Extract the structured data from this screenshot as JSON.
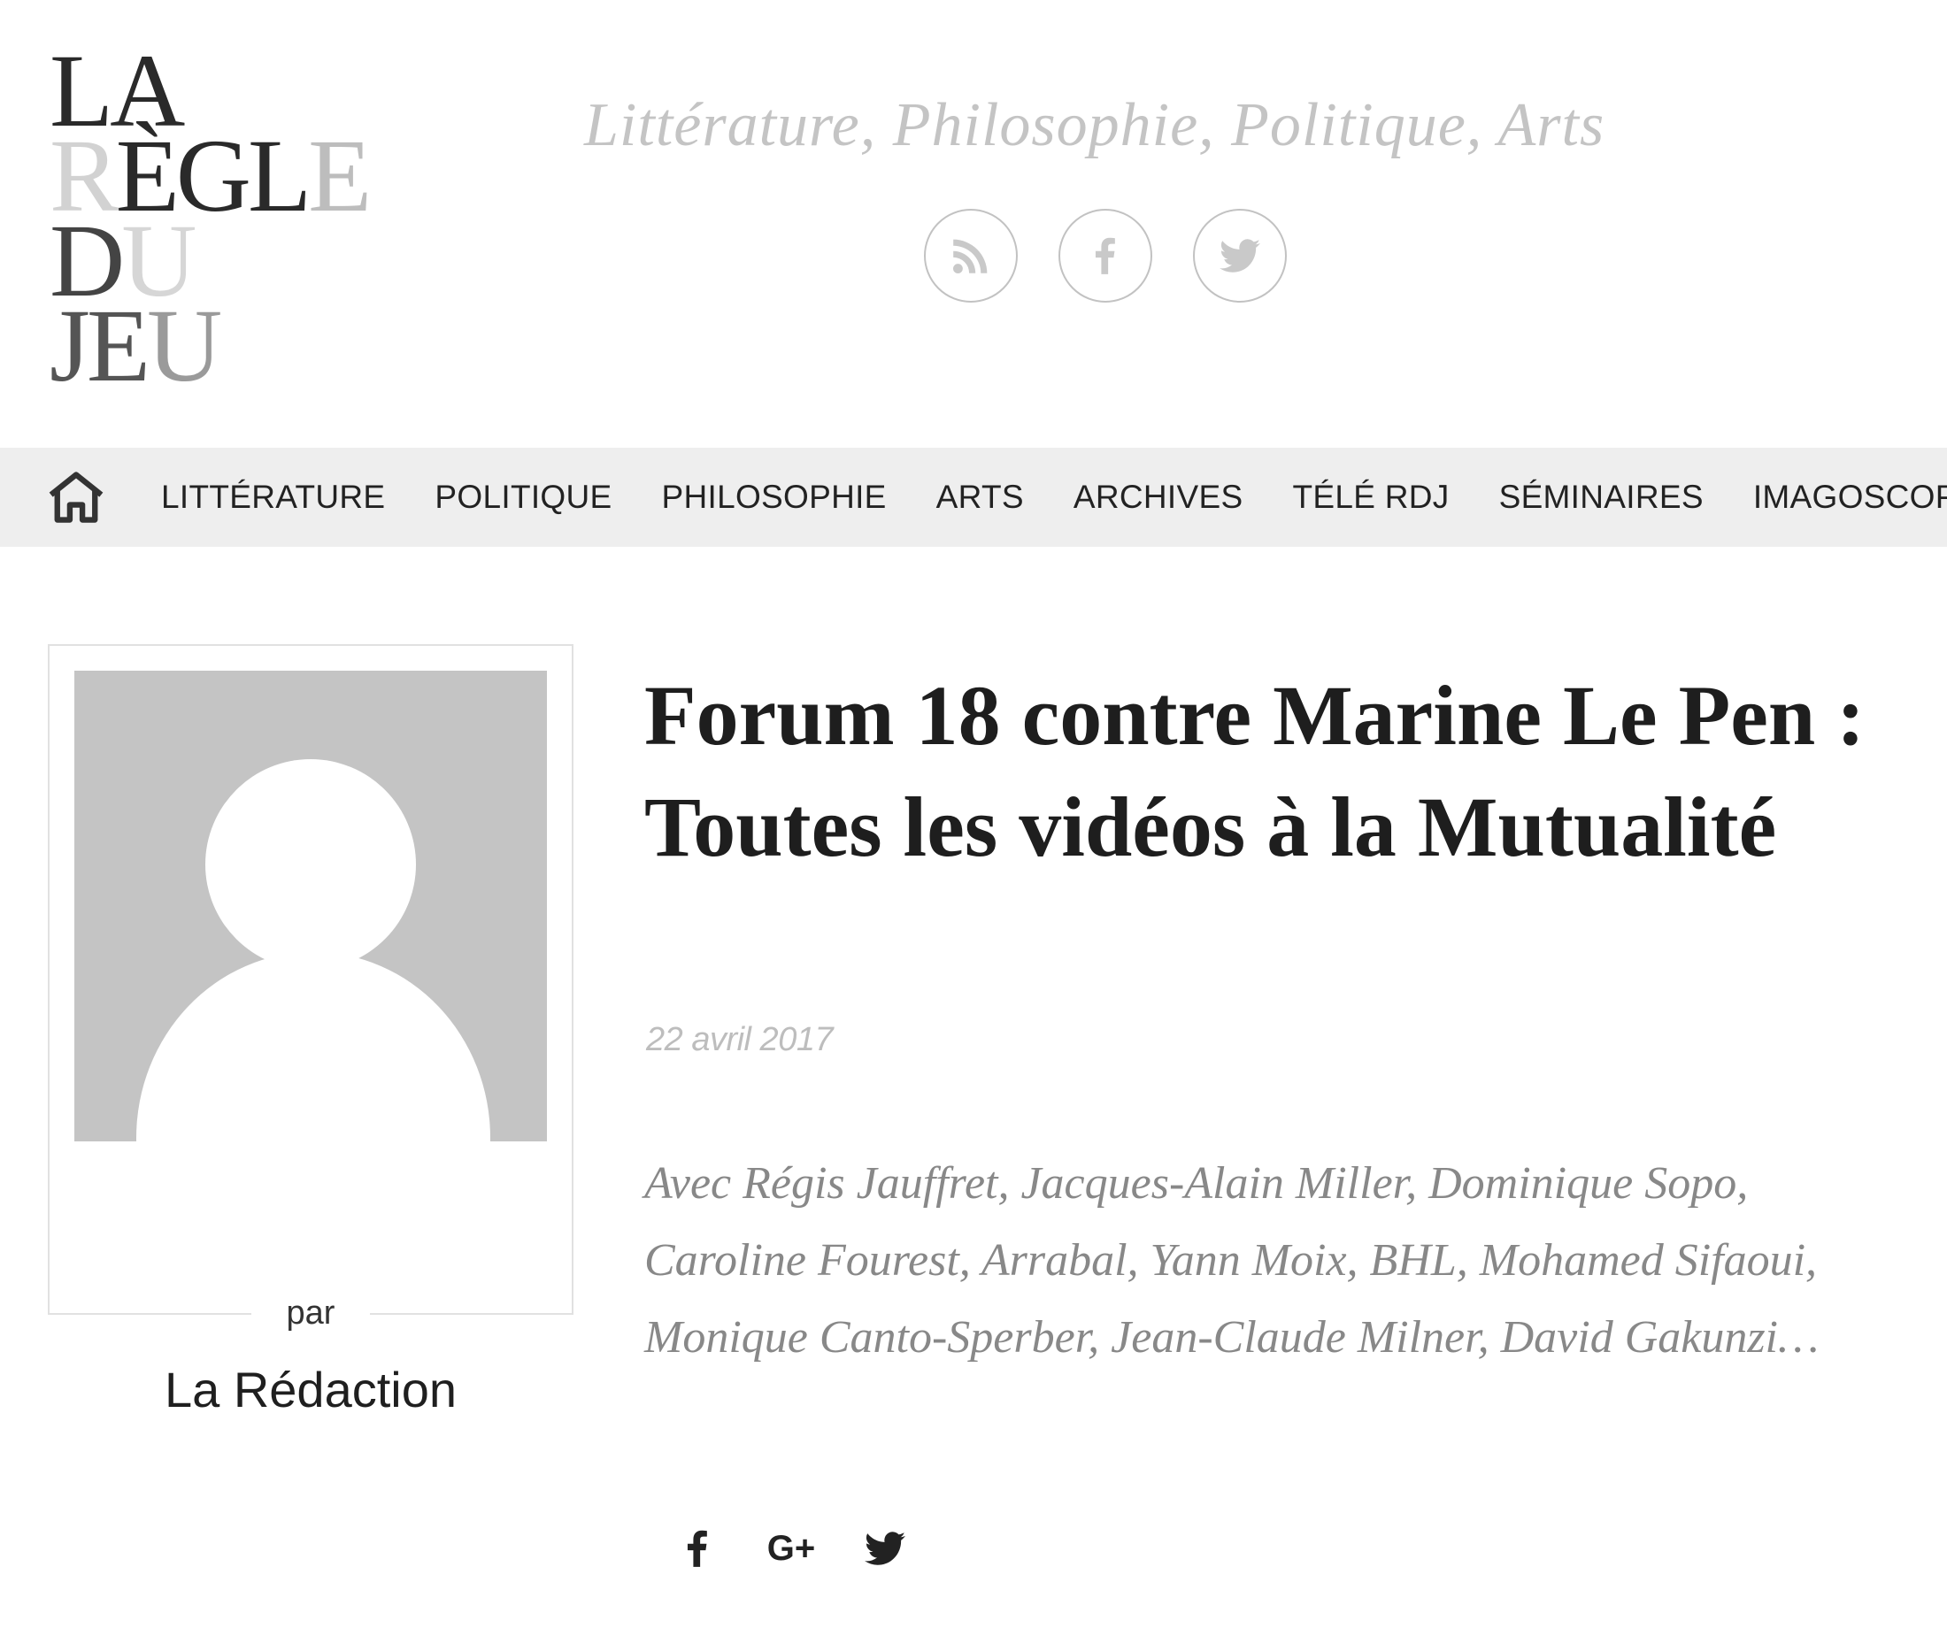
{
  "header": {
    "logo_lines": [
      {
        "dark": "LA",
        "light": ""
      },
      {
        "light": "R",
        "dark": "ÈGL",
        "light2": "E"
      },
      {
        "dark": "D",
        "light": "U"
      },
      {
        "dark": "JE",
        "light": "U"
      }
    ],
    "tagline": "Littérature, Philosophie, Politique, Arts",
    "social_icons": [
      "rss-icon",
      "facebook-icon",
      "twitter-icon"
    ]
  },
  "nav": {
    "home_icon": "home-icon",
    "items": [
      "LITTÉRATURE",
      "POLITIQUE",
      "PHILOSOPHIE",
      "ARTS",
      "ARCHIVES",
      "TÉLÉ RDJ",
      "SÉMINAIRES",
      "IMAGOSCOPE"
    ]
  },
  "author": {
    "by_label": "par",
    "name": "La Rédaction"
  },
  "article": {
    "title": "Forum 18 contre Marine Le Pen : Toutes les vidéos à la Mutualité",
    "date": "22 avril 2017",
    "excerpt": "Avec Régis Jauffret, Jacques-Alain Miller, Dominique Sopo, Caroline Fourest, Arrabal, Yann Moix, BHL, Mohamed Sifaoui, Monique Canto-Sperber, Jean-Claude Milner, David Gakunzi…",
    "share_icons": [
      "facebook-icon",
      "google-plus-icon",
      "twitter-icon"
    ],
    "gplus_label": "G+"
  },
  "colors": {
    "nav_bg": "#eeeeee",
    "tagline": "#c4c4c4",
    "avatar_bg": "#c4c4c4",
    "excerpt": "#888888"
  }
}
